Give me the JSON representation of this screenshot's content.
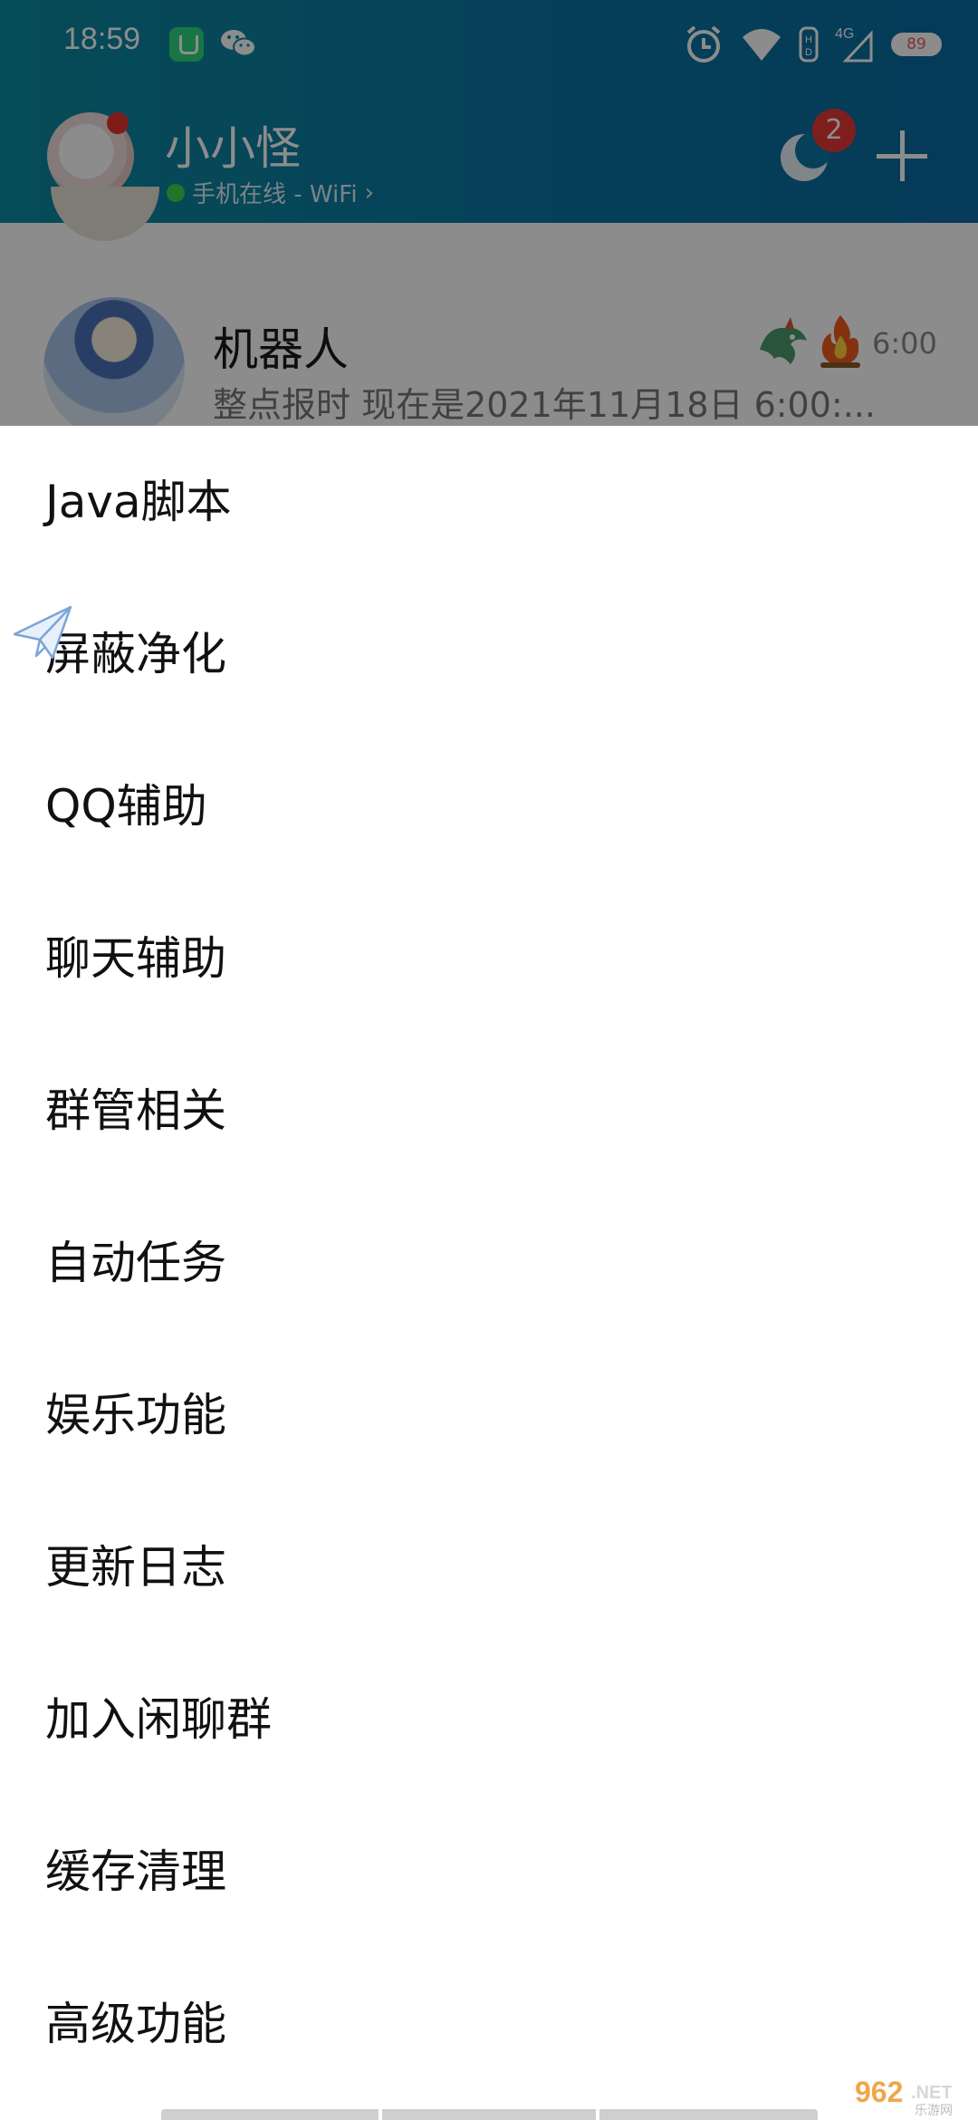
{
  "status_bar": {
    "time": "18:59",
    "network": "4G",
    "battery": "89"
  },
  "header": {
    "profile_name": "小小怪",
    "profile_status": "手机在线 - WiFi",
    "status_chevron": "›",
    "notification_count": "2"
  },
  "chat": {
    "name": "机器人",
    "preview": "整点报时 现在是2021年11月18日  6:00:...",
    "time": "6:00"
  },
  "menu": {
    "items": [
      {
        "label": "Java脚本"
      },
      {
        "label": "屏蔽净化"
      },
      {
        "label": "QQ辅助"
      },
      {
        "label": "聊天辅助"
      },
      {
        "label": "群管相关"
      },
      {
        "label": "自动任务"
      },
      {
        "label": "娱乐功能"
      },
      {
        "label": "更新日志"
      },
      {
        "label": "加入闲聊群"
      },
      {
        "label": "缓存清理"
      },
      {
        "label": "高级功能"
      }
    ]
  },
  "watermark": {
    "text_main": "962",
    "text_suffix": ".NET",
    "text_sub": "乐游网"
  },
  "colors": {
    "header_start": "#0b8aa0",
    "header_end": "#0a6aa0",
    "badge": "#e53935",
    "online": "#3cd34b"
  },
  "icons": [
    "wechat-icon",
    "alarm-icon",
    "wifi-icon",
    "battery-icon",
    "moon-icon",
    "plus-icon",
    "paper-plane-icon"
  ]
}
